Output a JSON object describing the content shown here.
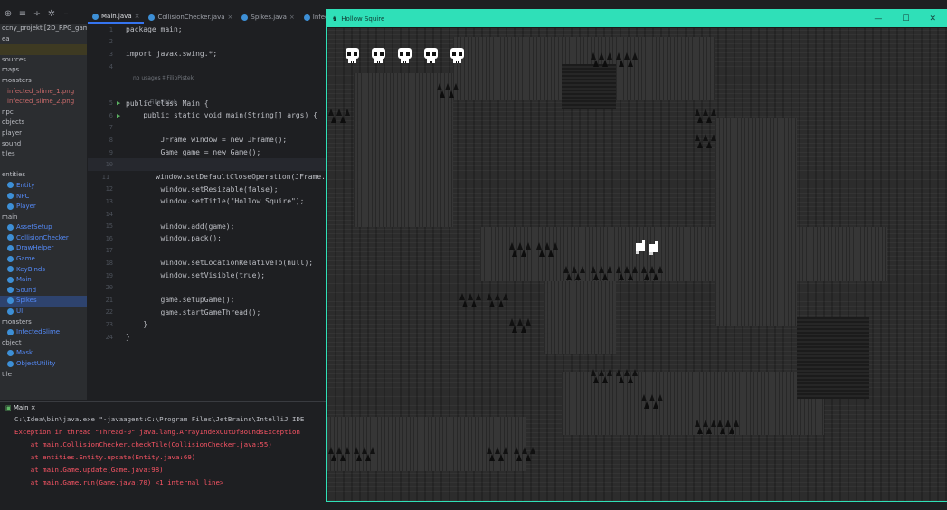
{
  "ide": {
    "project_label": "Hollow Squire",
    "tabs": [
      {
        "label": "Main.java",
        "active": true
      },
      {
        "label": "CollisionChecker.java",
        "active": false
      },
      {
        "label": "Spikes.java",
        "active": false
      },
      {
        "label": "Infected",
        "active": false
      }
    ],
    "tree": [
      {
        "label": "ocny_projekt [2D_RPG_gam",
        "kind": "root"
      },
      {
        "label": "ea",
        "kind": "dir"
      },
      {
        "label": "",
        "kind": "highlight"
      },
      {
        "label": "sources",
        "kind": "dir"
      },
      {
        "label": "maps",
        "kind": "dir"
      },
      {
        "label": "monsters",
        "kind": "dir"
      },
      {
        "label": "infected_slime_1.png",
        "kind": "file"
      },
      {
        "label": "infected_slime_2.png",
        "kind": "file"
      },
      {
        "label": "npc",
        "kind": "dir"
      },
      {
        "label": "objects",
        "kind": "dir"
      },
      {
        "label": "player",
        "kind": "dir"
      },
      {
        "label": "sound",
        "kind": "dir"
      },
      {
        "label": "tiles",
        "kind": "dir"
      },
      {
        "label": "",
        "kind": "dir"
      },
      {
        "label": "entities",
        "kind": "dir"
      },
      {
        "label": "Entity",
        "kind": "class"
      },
      {
        "label": "NPC",
        "kind": "class"
      },
      {
        "label": "Player",
        "kind": "class"
      },
      {
        "label": "main",
        "kind": "dir"
      },
      {
        "label": "AssetSetup",
        "kind": "class"
      },
      {
        "label": "CollisionChecker",
        "kind": "class"
      },
      {
        "label": "DrawHelper",
        "kind": "class"
      },
      {
        "label": "Game",
        "kind": "class"
      },
      {
        "label": "KeyBinds",
        "kind": "class"
      },
      {
        "label": "Main",
        "kind": "class"
      },
      {
        "label": "Sound",
        "kind": "class"
      },
      {
        "label": "Spikes",
        "kind": "class-selected"
      },
      {
        "label": "UI",
        "kind": "class"
      },
      {
        "label": "monsters",
        "kind": "dir"
      },
      {
        "label": "InfectedSlime",
        "kind": "class"
      },
      {
        "label": "object",
        "kind": "dir"
      },
      {
        "label": "Mask",
        "kind": "class"
      },
      {
        "label": "ObjectUtility",
        "kind": "class"
      },
      {
        "label": "tile",
        "kind": "dir"
      }
    ],
    "code_lines": [
      {
        "n": "1",
        "text": "package main;"
      },
      {
        "n": "2",
        "text": ""
      },
      {
        "n": "3",
        "text": "import javax.swing.*;"
      },
      {
        "n": "4",
        "text": ""
      },
      {
        "n": "5",
        "text": "public class Main {"
      },
      {
        "n": "6",
        "text": "    public static void main(String[] args) {"
      },
      {
        "n": "7",
        "text": ""
      },
      {
        "n": "8",
        "text": "        JFrame window = new JFrame();"
      },
      {
        "n": "9",
        "text": "        Game game = new Game();"
      },
      {
        "n": "10",
        "text": ""
      },
      {
        "n": "11",
        "text": "        window.setDefaultCloseOperation(JFrame."
      },
      {
        "n": "12",
        "text": "        window.setResizable(false);"
      },
      {
        "n": "13",
        "text": "        window.setTitle(\"Hollow Squire\");"
      },
      {
        "n": "14",
        "text": ""
      },
      {
        "n": "15",
        "text": "        window.add(game);"
      },
      {
        "n": "16",
        "text": "        window.pack();"
      },
      {
        "n": "17",
        "text": ""
      },
      {
        "n": "18",
        "text": "        window.setLocationRelativeTo(null);"
      },
      {
        "n": "19",
        "text": "        window.setVisible(true);"
      },
      {
        "n": "20",
        "text": ""
      },
      {
        "n": "21",
        "text": "        game.setupGame();"
      },
      {
        "n": "22",
        "text": "        game.startGameThread();"
      },
      {
        "n": "23",
        "text": "    }"
      },
      {
        "n": "24",
        "text": "}"
      }
    ],
    "hint_usages": "no usages  ‡ FilipPistek",
    "hint_author": "‡ FilipPistek",
    "console": {
      "tab_label": "Main",
      "lines": [
        {
          "text": "C:\\Idea\\bin\\java.exe \"-javaagent:C:\\Program Files\\JetBrains\\IntelliJ IDE",
          "kind": "cmd"
        },
        {
          "text": "Exception in thread \"Thread-0\" java.lang.ArrayIndexOutOfBoundsException",
          "kind": "err"
        },
        {
          "text": "    at main.CollisionChecker.checkTile(CollisionChecker.java:55)",
          "kind": "err"
        },
        {
          "text": "    at entities.Entity.update(Entity.java:69)",
          "kind": "err"
        },
        {
          "text": "    at main.Game.update(Game.java:98)",
          "kind": "err"
        },
        {
          "text": "    at main.Game.run(Game.java:70) <1 internal line>",
          "kind": "err"
        }
      ]
    }
  },
  "game": {
    "title": "Hollow Squire",
    "lives": 5,
    "accent_color": "#2fe0b8"
  }
}
